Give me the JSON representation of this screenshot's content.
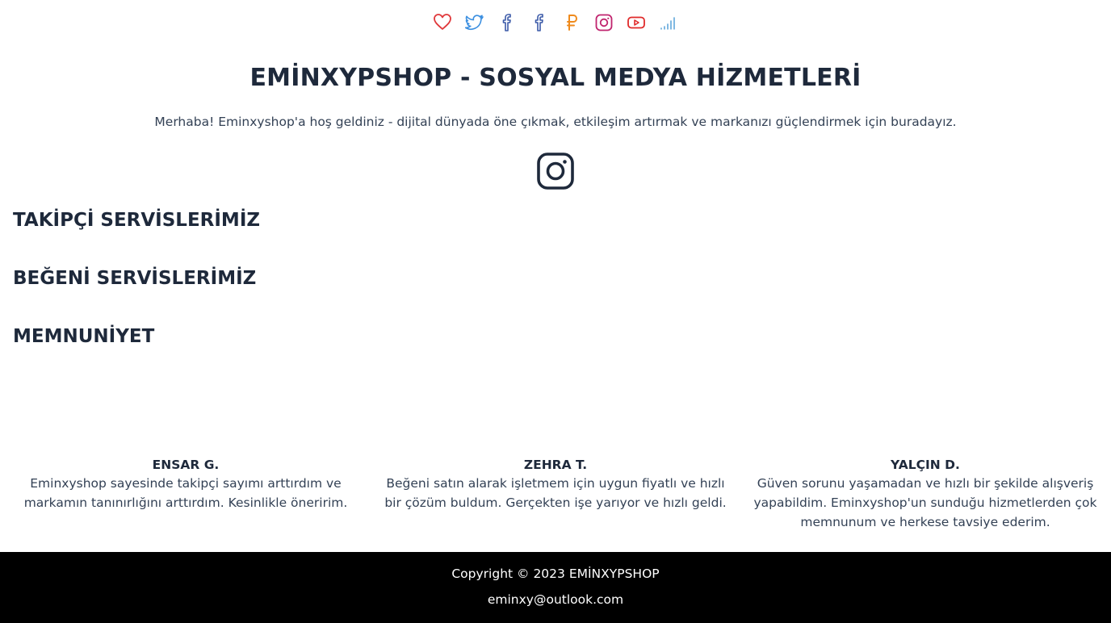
{
  "social_icons": [
    "heart-icon",
    "twitter-icon",
    "facebook-icon",
    "facebook-icon",
    "ruble-icon",
    "instagram-icon",
    "youtube-icon",
    "signal-icon"
  ],
  "colors": {
    "heart": "#e0383b",
    "twitter": "#3b8fe0",
    "facebook": "#3b5aa8",
    "ruble": "#ef8a1c",
    "instagram": "#c0246e",
    "youtube": "#e02a2a",
    "signal": "#4a9bd6",
    "text": "#1e293b",
    "footer_bg": "#000000"
  },
  "header": {
    "title": "EMİNXYPSHOP - SOSYAL MEDYA HİZMETLERİ",
    "intro": "Merhaba! Eminxyshop'a hoş geldiniz - dijital dünyada öne çıkmak, etkileşim artırmak ve markanızı güçlendirmek için buradayız."
  },
  "sections": [
    {
      "heading": "TAKİPÇİ SERVİSLERİMİZ"
    },
    {
      "heading": "BEĞENİ SERVİSLERİMİZ"
    },
    {
      "heading": "MEMNUNİYET"
    }
  ],
  "reviews": [
    {
      "name": "ENSAR G.",
      "text": "Eminxyshop sayesinde takipçi sayımı arttırdım ve markamın tanınırlığını arttırdım. Kesinlikle öneririm."
    },
    {
      "name": "ZEHRA T.",
      "text": "Beğeni satın alarak işletmem için uygun fiyatlı ve hızlı bir çözüm buldum. Gerçekten işe yarıyor ve hızlı geldi."
    },
    {
      "name": "YALÇIN D.",
      "text": "Güven sorunu yaşamadan ve hızlı bir şekilde alışveriş yapabildim. Eminxyshop'un sunduğu hizmetlerden çok memnunum ve herkese tavsiye ederim."
    }
  ],
  "footer": {
    "copyright": "Copyright © 2023 EMİNXYPSHOP",
    "email": "eminxy@outlook.com"
  }
}
